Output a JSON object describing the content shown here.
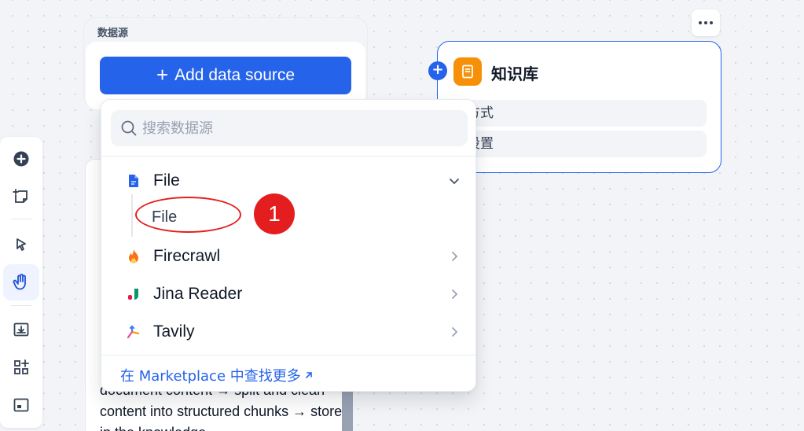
{
  "data_source_node": {
    "title": "数据源",
    "add_button_label": "Add data source"
  },
  "knowledge_node": {
    "title": "知识库",
    "rows": [
      "引方式",
      "索设置"
    ],
    "accent_color": "#2563eb",
    "icon_color": "#f79009"
  },
  "dropdown": {
    "search_placeholder": "搜索数据源",
    "items": [
      {
        "label": "File",
        "icon": "file-icon",
        "expanded": true
      },
      {
        "label": "Firecrawl",
        "icon": "firecrawl-flame-icon"
      },
      {
        "label": "Jina Reader",
        "icon": "jina-reader-icon"
      },
      {
        "label": "Tavily",
        "icon": "tavily-icon"
      }
    ],
    "sub_items": [
      "File"
    ],
    "marketplace_link": "在 Marketplace 中查找更多"
  },
  "annotation": {
    "badge_number": "1",
    "color": "#e41e1e"
  },
  "background_card": {
    "text": "document content → split and clean content into structured chunks → store in the knowledge"
  },
  "toolbar": {
    "tools": [
      "add-node-icon",
      "add-note-icon",
      "pointer-icon",
      "hand-icon",
      "export-image-icon",
      "organize-blocks-icon",
      "minimap-icon"
    ],
    "active_tool": "hand-icon"
  }
}
